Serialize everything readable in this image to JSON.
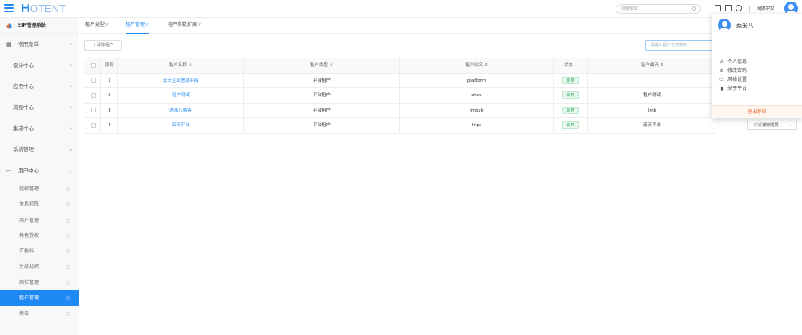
{
  "header": {
    "logo_main": "H",
    "logo_rest": "OTENT",
    "search_placeholder": "搜索菜单",
    "language": "简体中文"
  },
  "sidebar": {
    "system_title": "EIP管理系统",
    "items": [
      {
        "label": "常用菜单",
        "chevron": "›"
      },
      {
        "label": "设计中心",
        "chevron": "›"
      },
      {
        "label": "应用中心",
        "chevron": "›"
      },
      {
        "label": "流程中心",
        "chevron": "›"
      },
      {
        "label": "集成中心",
        "chevron": "›"
      },
      {
        "label": "系统管理",
        "chevron": "›"
      },
      {
        "label": "用户中心",
        "chevron": "⌄"
      }
    ],
    "sub_items": [
      {
        "label": "组织管理"
      },
      {
        "label": "关系矩阵"
      },
      {
        "label": "用户管理"
      },
      {
        "label": "角色授权"
      },
      {
        "label": "汇报线"
      },
      {
        "label": "分级组织"
      },
      {
        "label": "岗位管理"
      },
      {
        "label": "租户管理",
        "active": true
      },
      {
        "label": "表单"
      }
    ]
  },
  "tabs": [
    {
      "label": "租户类型☆"
    },
    {
      "label": "租户管理☆",
      "active": true
    },
    {
      "label": "租户参数扩展☆"
    }
  ],
  "toolbar": {
    "add_label": "+ 添加租户",
    "search_placeholder": "请输入租户名称搜索"
  },
  "table": {
    "headers": {
      "index": "序号",
      "name": "租户名称 ⇕",
      "type": "租户类型 ⇕",
      "alias": "租户别名 ⇕",
      "state": "状态 ⌄",
      "code": "租户编码 ⇕"
    },
    "rows": [
      {
        "index": "1",
        "name": "宏天企业信息平台",
        "type": "平台租户",
        "alias": "platform",
        "state": "启用",
        "code": ""
      },
      {
        "index": "2",
        "name": "租户测试",
        "type": "平台租户",
        "alias": "zhcs",
        "state": "启用",
        "code": "租户测试"
      },
      {
        "index": "3",
        "name": "两米八租客",
        "type": "平台租户",
        "alias": "lmbzk",
        "state": "启用",
        "code": "lmb"
      },
      {
        "index": "4",
        "name": "宏天平台",
        "type": "平台租户",
        "alias": "htpt",
        "state": "启用",
        "code": "宏天平台"
      }
    ],
    "row4_action": "只设置管理员"
  },
  "user_menu": {
    "name": "两米八",
    "items": [
      {
        "label": "个人信息",
        "icon": "user-icon"
      },
      {
        "label": "修改密码",
        "icon": "gear-icon"
      },
      {
        "label": "风格设置",
        "icon": "monitor-icon"
      },
      {
        "label": "关于平台",
        "icon": "bookmark-icon"
      }
    ],
    "logout": "退出系统"
  },
  "colors": {
    "primary": "#1e88f5",
    "active_sidebar": "#1e88f5",
    "badge_green": "#27a55a",
    "logout_orange": "#e8703a"
  }
}
